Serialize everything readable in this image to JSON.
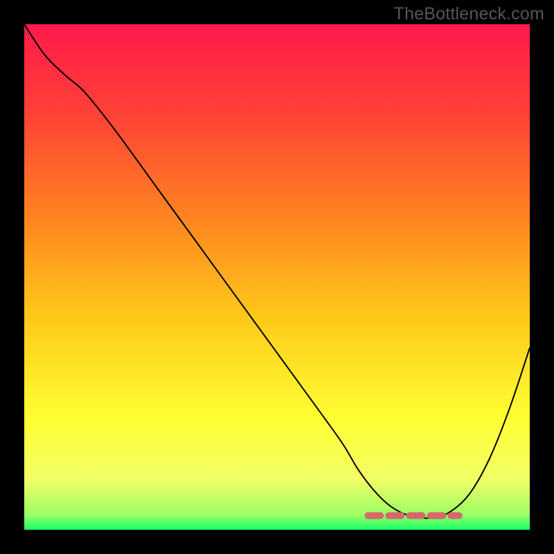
{
  "watermark": "TheBottleneck.com",
  "colors": {
    "frame": "#000000",
    "curve": "#000000",
    "flat_marker": "#d46a6a",
    "gradient": [
      "#ff1a4b",
      "#ff4236",
      "#ff8a1f",
      "#ffc91a",
      "#ffff33",
      "#f2ff66",
      "#9cff66",
      "#1aff66"
    ]
  },
  "chart_data": {
    "type": "line",
    "title": "",
    "xlabel": "",
    "ylabel": "",
    "xlim": [
      0,
      100
    ],
    "ylim": [
      0,
      100
    ],
    "series": [
      {
        "name": "bottleneck-curve",
        "x": [
          0,
          4,
          8,
          12,
          18,
          26,
          34,
          42,
          50,
          58,
          63,
          66,
          69,
          72,
          75,
          78,
          81,
          84,
          88,
          92,
          96,
          100
        ],
        "y": [
          100,
          94,
          90,
          86.5,
          79,
          68,
          57,
          46,
          35,
          24,
          17,
          12,
          8,
          5,
          3.2,
          2.4,
          2.4,
          3.4,
          7,
          14,
          24,
          36
        ]
      }
    ],
    "annotations": [
      {
        "name": "optimal-zone",
        "x_start": 68,
        "x_end": 86,
        "y": 2.8
      }
    ]
  }
}
